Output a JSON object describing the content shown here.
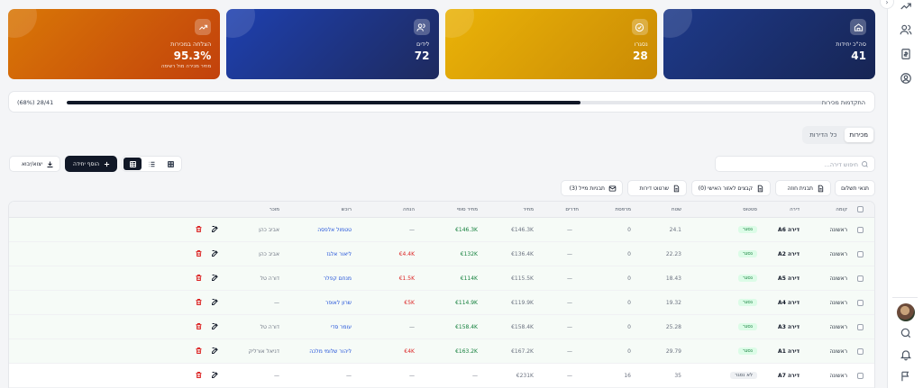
{
  "stats": [
    {
      "label": "סה\"כ יחידות",
      "value": "41",
      "sub": "",
      "icon": "home-icon",
      "color": "#1e3a8a"
    },
    {
      "label": "נסגרו",
      "value": "28",
      "sub": "",
      "icon": "check-circle-icon",
      "color": "#eab308"
    },
    {
      "label": "לידים",
      "value": "72",
      "sub": "",
      "icon": "users-icon",
      "color": "#1e40af"
    },
    {
      "label": "הצלחה במכירות",
      "value": "95.3%",
      "sub": "מחיר מכירה מול רשימה",
      "icon": "trending-up-icon",
      "color": "#d97706"
    }
  ],
  "progress": {
    "title": "התקדמות מכירות",
    "count": "(68%) 28/41",
    "fraction": 0.68
  },
  "tabs": [
    {
      "label": "מכירות",
      "active": true
    },
    {
      "label": "כל הדירות",
      "active": false
    }
  ],
  "search": {
    "placeholder": "חיפוש דירה..."
  },
  "toolbar": {
    "add_unit": "הוסף יחידה",
    "export_import": "יצוא/יבוא",
    "payment_terms": "תנאי תשלום",
    "contract_template": "תבנית חוזה",
    "personal_files": "קבצים לאזור האישי (0)",
    "unit_plans": "שרטוט דירות",
    "email_templates": "תבניות מייל (3)"
  },
  "table": {
    "headers": {
      "floor": "קומה",
      "unit": "דירה",
      "status": "סטטוס",
      "area": "שטח",
      "balcony": "מרפסת",
      "rooms": "חדרים",
      "price": "מחיר",
      "final_price": "מחיר סופי",
      "discount": "הנחה",
      "buyer": "רוכש",
      "seller": "מוכר"
    },
    "rows": [
      {
        "floor": "ראשונה",
        "unit": "דירה A6",
        "status": "נסגר",
        "sold": true,
        "area": "24.1",
        "balcony": "0",
        "rooms": "—",
        "price": "€146.3K",
        "final_price": "€146.3K",
        "discount": "—",
        "discount_red": false,
        "buyer": "טטמול אלפסה",
        "seller": "אביב כהן"
      },
      {
        "floor": "ראשונה",
        "unit": "דירה A2",
        "status": "נסגר",
        "sold": true,
        "area": "22.23",
        "balcony": "0",
        "rooms": "—",
        "price": "€136.4K",
        "final_price": "€132K",
        "discount": "€4.4K",
        "discount_red": true,
        "buyer": "ליאור אלגז",
        "seller": "אביב כהן"
      },
      {
        "floor": "ראשונה",
        "unit": "דירה A5",
        "status": "נסגר",
        "sold": true,
        "area": "18.43",
        "balcony": "0",
        "rooms": "—",
        "price": "€115.5K",
        "final_price": "€114K",
        "discount": "€1.5K",
        "discount_red": true,
        "buyer": "מנחם קפלר",
        "seller": "דורה טל"
      },
      {
        "floor": "ראשונה",
        "unit": "דירה A4",
        "status": "נסגר",
        "sold": true,
        "area": "19.32",
        "balcony": "0",
        "rooms": "—",
        "price": "€119.9K",
        "final_price": "€114.9K",
        "discount": "€5K",
        "discount_red": true,
        "buyer": "שרון לאופר",
        "seller": "—"
      },
      {
        "floor": "ראשונה",
        "unit": "דירה A3",
        "status": "נסגר",
        "sold": true,
        "area": "25.28",
        "balcony": "0",
        "rooms": "—",
        "price": "€158.4K",
        "final_price": "€158.4K",
        "discount": "—",
        "discount_red": false,
        "buyer": "עומר סדי",
        "seller": "דורה טל"
      },
      {
        "floor": "ראשונה",
        "unit": "דירה A1",
        "status": "נסגר",
        "sold": true,
        "area": "29.79",
        "balcony": "0",
        "rooms": "—",
        "price": "€167.2K",
        "final_price": "€163.2K",
        "discount": "€4K",
        "discount_red": true,
        "buyer": "ליהור שלומי מלכה",
        "seller": "דניאל אורליק"
      },
      {
        "floor": "ראשונה",
        "unit": "דירה A7",
        "status": "לא נסגר",
        "sold": false,
        "area": "35",
        "balcony": "16",
        "rooms": "—",
        "price": "€231K",
        "final_price": "—",
        "discount": "—",
        "discount_red": false,
        "buyer": "—",
        "seller": "—"
      }
    ]
  }
}
